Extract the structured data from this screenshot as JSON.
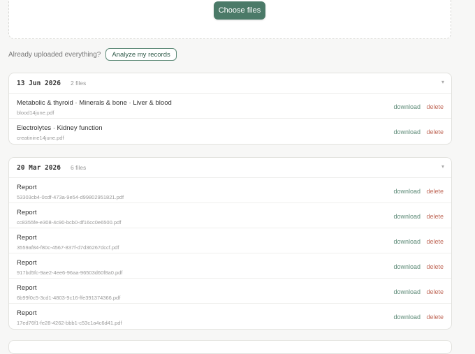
{
  "upload": {
    "choose_label": "Choose files"
  },
  "cta": {
    "text": "Already uploaded everything?",
    "analyze_label": "Analyze my records"
  },
  "groups": [
    {
      "date": "13 Jun 2026",
      "count": "2 files",
      "files": [
        {
          "title": "Metabolic & thyroid · Minerals & bone · Liver & blood",
          "filename": "blood14june.pdf",
          "download": "download",
          "delete": "delete"
        },
        {
          "title": "Electrolytes · Kidney function",
          "filename": "creatinine14june.pdf",
          "download": "download",
          "delete": "delete"
        }
      ]
    },
    {
      "date": "20 Mar 2026",
      "count": "6 files",
      "files": [
        {
          "title": "Report",
          "filename": "53303cb4-0cdf-473a-9e54-d99802951821.pdf",
          "download": "download",
          "delete": "delete"
        },
        {
          "title": "Report",
          "filename": "cc8355fe-e308-4c90-bcb0-df16cc0e6500.pdf",
          "download": "download",
          "delete": "delete"
        },
        {
          "title": "Report",
          "filename": "3559af84-f80c-4567-837f-d7d36267dccf.pdf",
          "download": "download",
          "delete": "delete"
        },
        {
          "title": "Report",
          "filename": "917bd5fc-9ae2-4ee6-96aa-96503d60f8a0.pdf",
          "download": "download",
          "delete": "delete"
        },
        {
          "title": "Report",
          "filename": "6b99f0c5-3cd1-4803-9c16-ffe391374366.pdf",
          "download": "download",
          "delete": "delete"
        },
        {
          "title": "Report",
          "filename": "17ed76f1-fe28-4262-bbb1-c53c1a4c6d41.pdf",
          "download": "download",
          "delete": "delete"
        }
      ]
    }
  ],
  "icons": {
    "group_toggle": "chevron-down-icon"
  },
  "colors": {
    "accent": "#4b7a68",
    "download": "#5d8a77",
    "delete": "#c06a5a"
  }
}
